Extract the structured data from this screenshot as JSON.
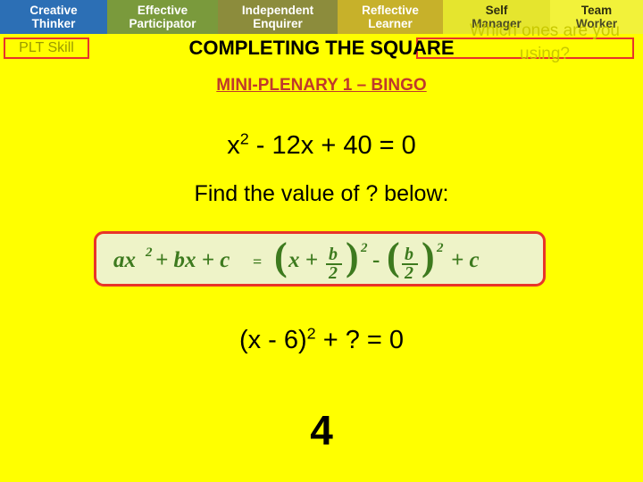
{
  "plt_bar": {
    "items": [
      {
        "line1": "Creative",
        "line2": "Thinker",
        "color": "#2C6FB5"
      },
      {
        "line1": "Effective",
        "line2": "Participator",
        "color": "#7A9A3C"
      },
      {
        "line1": "Independent",
        "line2": "Enquirer",
        "color": "#8C8C3C"
      },
      {
        "line1": "Reflective",
        "line2": "Learner",
        "color": "#C7B12A"
      },
      {
        "line1": "Self",
        "line2": "Manager",
        "color": "#E5E52E"
      },
      {
        "line1": "Team",
        "line2": "Worker",
        "color": "#F2F23A"
      }
    ]
  },
  "plt_skill_label": "PLT Skill",
  "which_ones_text": "Which ones are you using?",
  "title": "COMPLETING THE SQUARE",
  "subtitle": "MINI-PLENARY 1 – BINGO",
  "equation1": {
    "base": "x",
    "exponent": "2",
    "rest": " - 12x + 40 = 0"
  },
  "instruction": "Find the value of ? below:",
  "formula": {
    "lhs": "ax² + bx + c",
    "equals": "=",
    "rhs": "( x + b/2 )² - ( b/2 )² + c"
  },
  "equation2": {
    "pre": "(x - 6)",
    "exponent": "2",
    "post": " + ? = 0"
  },
  "answer": "4",
  "colors": {
    "background": "#FFFF00",
    "accent_red": "#E8342A",
    "subtitle_red": "#C0392B",
    "formula_green": "#3D7A1E",
    "formula_box_bg": "#EEF3C8"
  }
}
